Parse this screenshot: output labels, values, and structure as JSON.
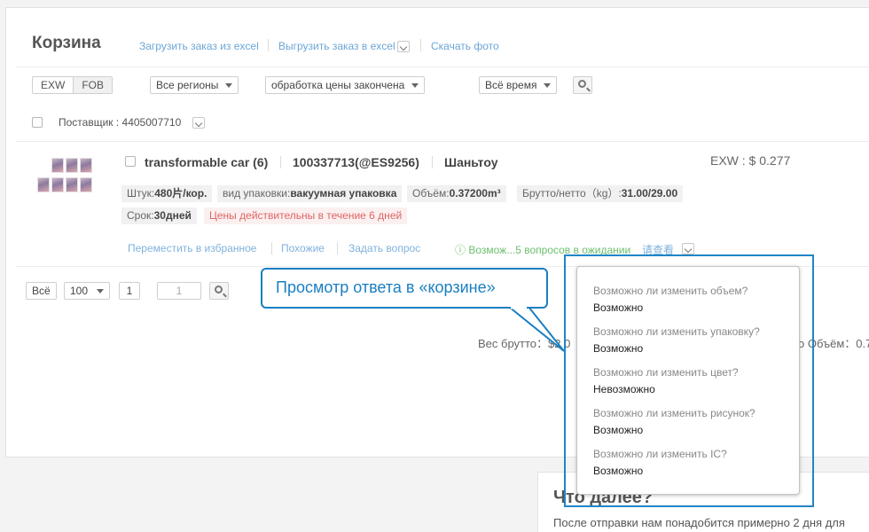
{
  "header": {
    "title": "Корзина",
    "links": [
      "Загрузить заказ из excel",
      "Выгрузить заказ в excel",
      "Скачать фото"
    ]
  },
  "filters": {
    "terms": [
      "EXW",
      "FOB"
    ],
    "region": "Все регионы",
    "status": "обработка цены закончена",
    "time": "Всё время"
  },
  "supplier": {
    "label": "Поставщик : 4405007710"
  },
  "item": {
    "name": "transformable car (6)",
    "code": "100337713(@ES9256)",
    "city": "Шаньтоу",
    "price": "EXW : $ 0.277",
    "tags": [
      {
        "label": "Штук:",
        "value": "480片/кор."
      },
      {
        "label": "вид упаковки:",
        "value": "вакуумная упаковка"
      },
      {
        "label": "Объём:",
        "value": "0.37200m³"
      },
      {
        "label": "Брутто/нетто（kg）:",
        "value": "31.00/29.00"
      },
      {
        "label": "Срок:",
        "value": "30дней"
      }
    ],
    "validity": "Цены действительны в течение 6 дней",
    "actions": [
      "Переместить в избранное",
      "Похожие",
      "Задать вопрос"
    ],
    "pending": "ⓘ Возмож...5 вопросов в ожидании",
    "chinese_link": "请查看"
  },
  "pager": {
    "all": "Всё",
    "per_page": "100",
    "page": "1",
    "goto": "1"
  },
  "summary": {
    "gross_weight": "Вес брутто：$2 0",
    "volume": "о Объём：0.7"
  },
  "callout": "Просмотр ответа в «корзине»",
  "qa": [
    {
      "q": "Возможно ли изменить объем?",
      "a": "Возможно"
    },
    {
      "q": "Возможно ли изменить упаковку?",
      "a": "Возможно"
    },
    {
      "q": "Возможно ли изменить цвет?",
      "a": "Невозможно"
    },
    {
      "q": "Возможно ли изменить рисунок?",
      "a": "Возможно"
    },
    {
      "q": "Возможно ли изменить IC?",
      "a": "Возможно"
    }
  ],
  "next": {
    "title": "Что далее?",
    "text": "После отправки нам понадобится примерно 2 дня для"
  },
  "colors": {
    "accent": "#1a7fc1",
    "link": "#6aa6d8",
    "warning": "#e06565",
    "success": "#6cbf6c"
  },
  "icons": [
    "search-icon",
    "checkbox-icon",
    "chevron-down-icon",
    "info-icon"
  ]
}
